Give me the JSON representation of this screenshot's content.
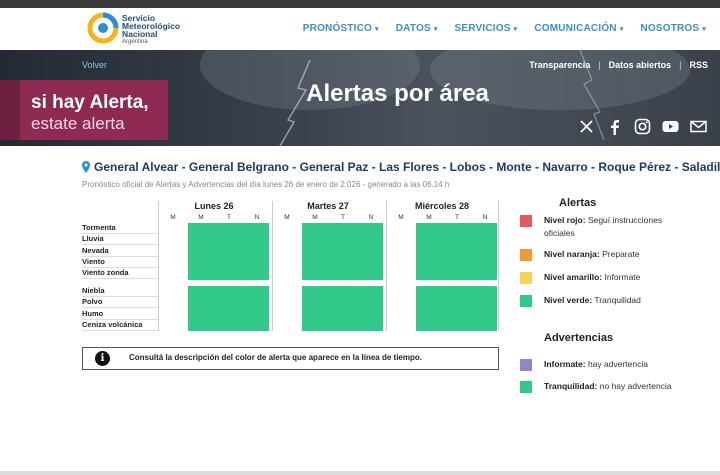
{
  "header": {
    "logo": {
      "line1": "Servicio",
      "line2": "Meteorológico",
      "line3": "Nacional",
      "line4": "Argentina"
    },
    "nav": [
      {
        "label": "PRONÓSTICO"
      },
      {
        "label": "DATOS"
      },
      {
        "label": "SERVICIOS"
      },
      {
        "label": "COMUNICACIÓN"
      },
      {
        "label": "NOSOTROS"
      }
    ]
  },
  "hero": {
    "back": "Volver",
    "links": [
      "Transparencia",
      "Datos abiertos",
      "RSS"
    ],
    "title": "Alertas por área",
    "banner_line1": "si hay Alerta,",
    "banner_line2": "estate alerta"
  },
  "location": {
    "areas": "General Alvear - General Belgrano - General Paz - Las Flores - Lobos - Monte - Navarro - Roque Pérez - Saladillo",
    "subtitle": "Pronóstico oficial de Alertas y Advertencias del día lunes 26 de enero de 2.026 - generado a las 06.14 h"
  },
  "timeline": {
    "days": [
      "Lunes 26",
      "Martes 27",
      "Miércoles 28"
    ],
    "slots": [
      "M",
      "M",
      "T",
      "N"
    ],
    "alert_rows": [
      "Tormenta",
      "Lluvia",
      "Nevada",
      "Viento",
      "Viento zonda"
    ],
    "warning_rows": [
      "Niebla",
      "Polvo",
      "Humo",
      "Ceniza volcánica"
    ],
    "level_all": "verde"
  },
  "info": {
    "text": "Consultá la descripción del color de alerta que aparece en la línea de tiempo."
  },
  "legend": {
    "alerts_title": "Alertas",
    "alerts": [
      {
        "name": "Nivel rojo:",
        "desc": "Seguí instrucciones oficiales",
        "color": "#e05a5f"
      },
      {
        "name": "Nivel naranja:",
        "desc": "Preparate",
        "color": "#f5963a"
      },
      {
        "name": "Nivel amarillo:",
        "desc": "Informate",
        "color": "#f7d25a"
      },
      {
        "name": "Nivel verde:",
        "desc": "Tranquilidad",
        "color": "#33c98a"
      }
    ],
    "warnings_title": "Advertencias",
    "warnings": [
      {
        "name": "Informate:",
        "desc": "hay advertencia",
        "color": "#8f87c9"
      },
      {
        "name": "Tranquilidad:",
        "desc": "no hay advertencia",
        "color": "#33c98a"
      }
    ]
  }
}
